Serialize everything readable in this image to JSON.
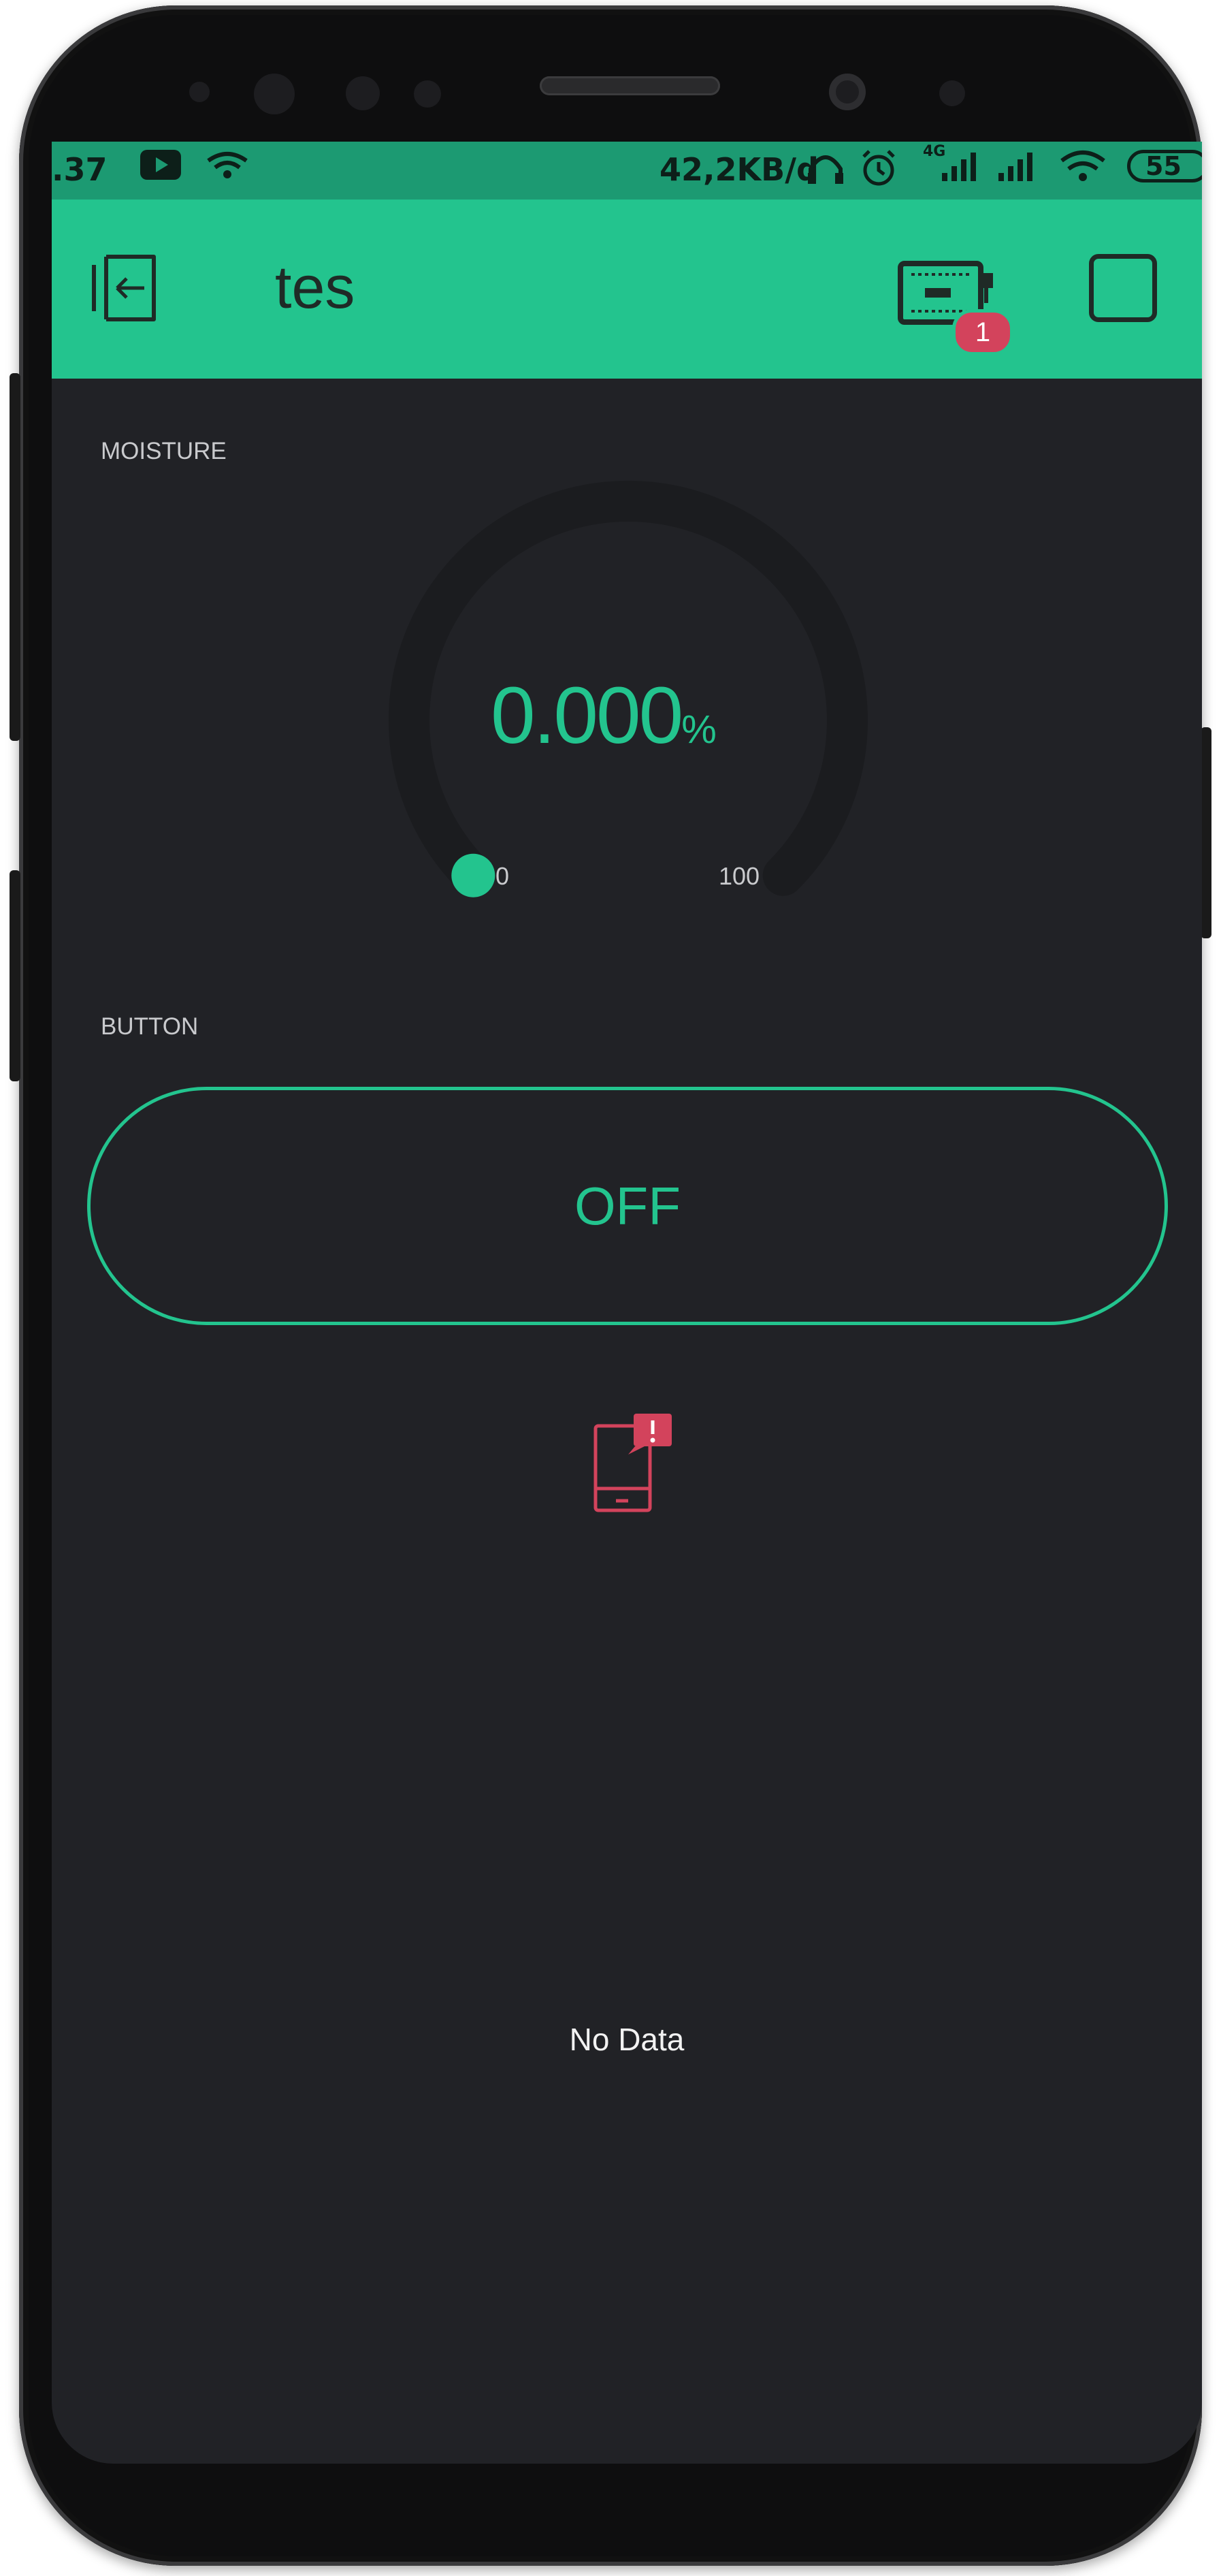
{
  "status_bar": {
    "time": ".37",
    "network_speed": "42,2KB/d",
    "network_type": "4G",
    "battery": "55"
  },
  "app_bar": {
    "title": "tes",
    "device_badge_count": "1"
  },
  "gauge": {
    "label": "MOISTURE",
    "value": "0.000",
    "unit": "%",
    "min": "0",
    "max": "100",
    "level_fraction": 0.0
  },
  "button_widget": {
    "label": "BUTTON",
    "state_text": "OFF"
  },
  "graph": {
    "empty_text": "No Data"
  },
  "colors": {
    "accent": "#23c48e",
    "background": "#212226",
    "alert": "#d3435c",
    "status_bar": "#1c9a72"
  },
  "icons": {
    "exit": "exit-icon",
    "device": "device-icon",
    "stop": "stop-icon",
    "device_offline": "device-offline-icon"
  }
}
